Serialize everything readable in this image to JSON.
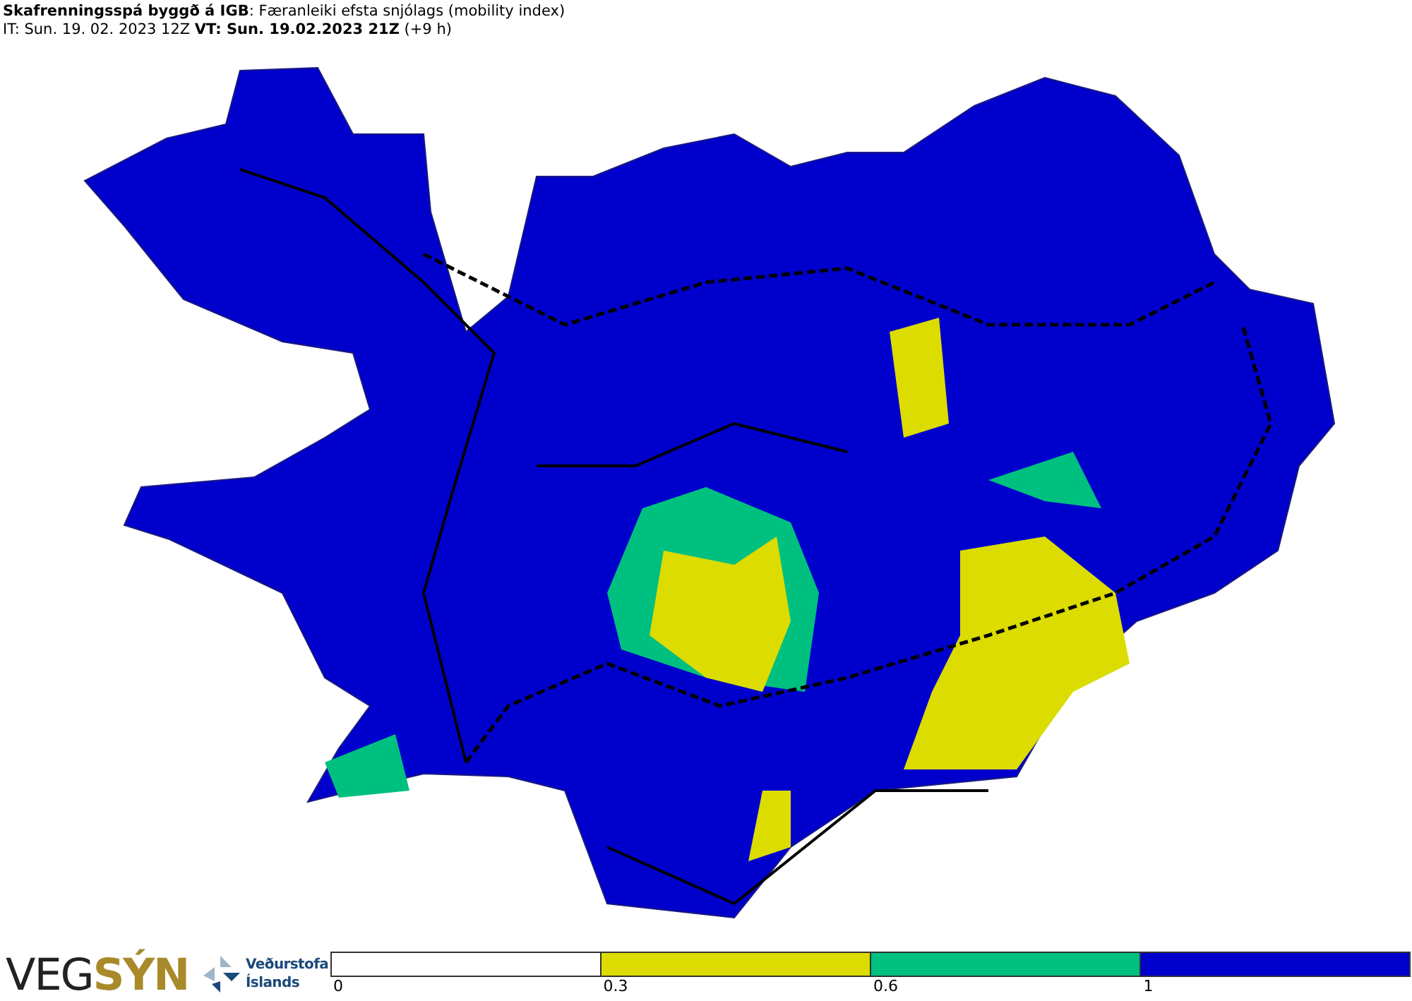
{
  "header": {
    "title": "**Skafrenningsspá byggð á IGB**: Færanleiki efsta snjólags (mobility index)",
    "times": "IT: Sun. 19. 02. 2023 12Z **VT: Sun. 19.02.2023 21Z** (+9 h)"
  },
  "logos": {
    "vegsyn": "VEG**SÝN**",
    "agency_lines": [
      "Veðurstofa",
      "Íslands"
    ]
  },
  "legend": [
    {
      "label": "0",
      "color": "#ffffff"
    },
    {
      "label": "0.3",
      "color": "#dcdc00"
    },
    {
      "label": "0.6",
      "color": "#00c080"
    },
    {
      "label": "1",
      "color": "#0000cc"
    }
  ]
}
